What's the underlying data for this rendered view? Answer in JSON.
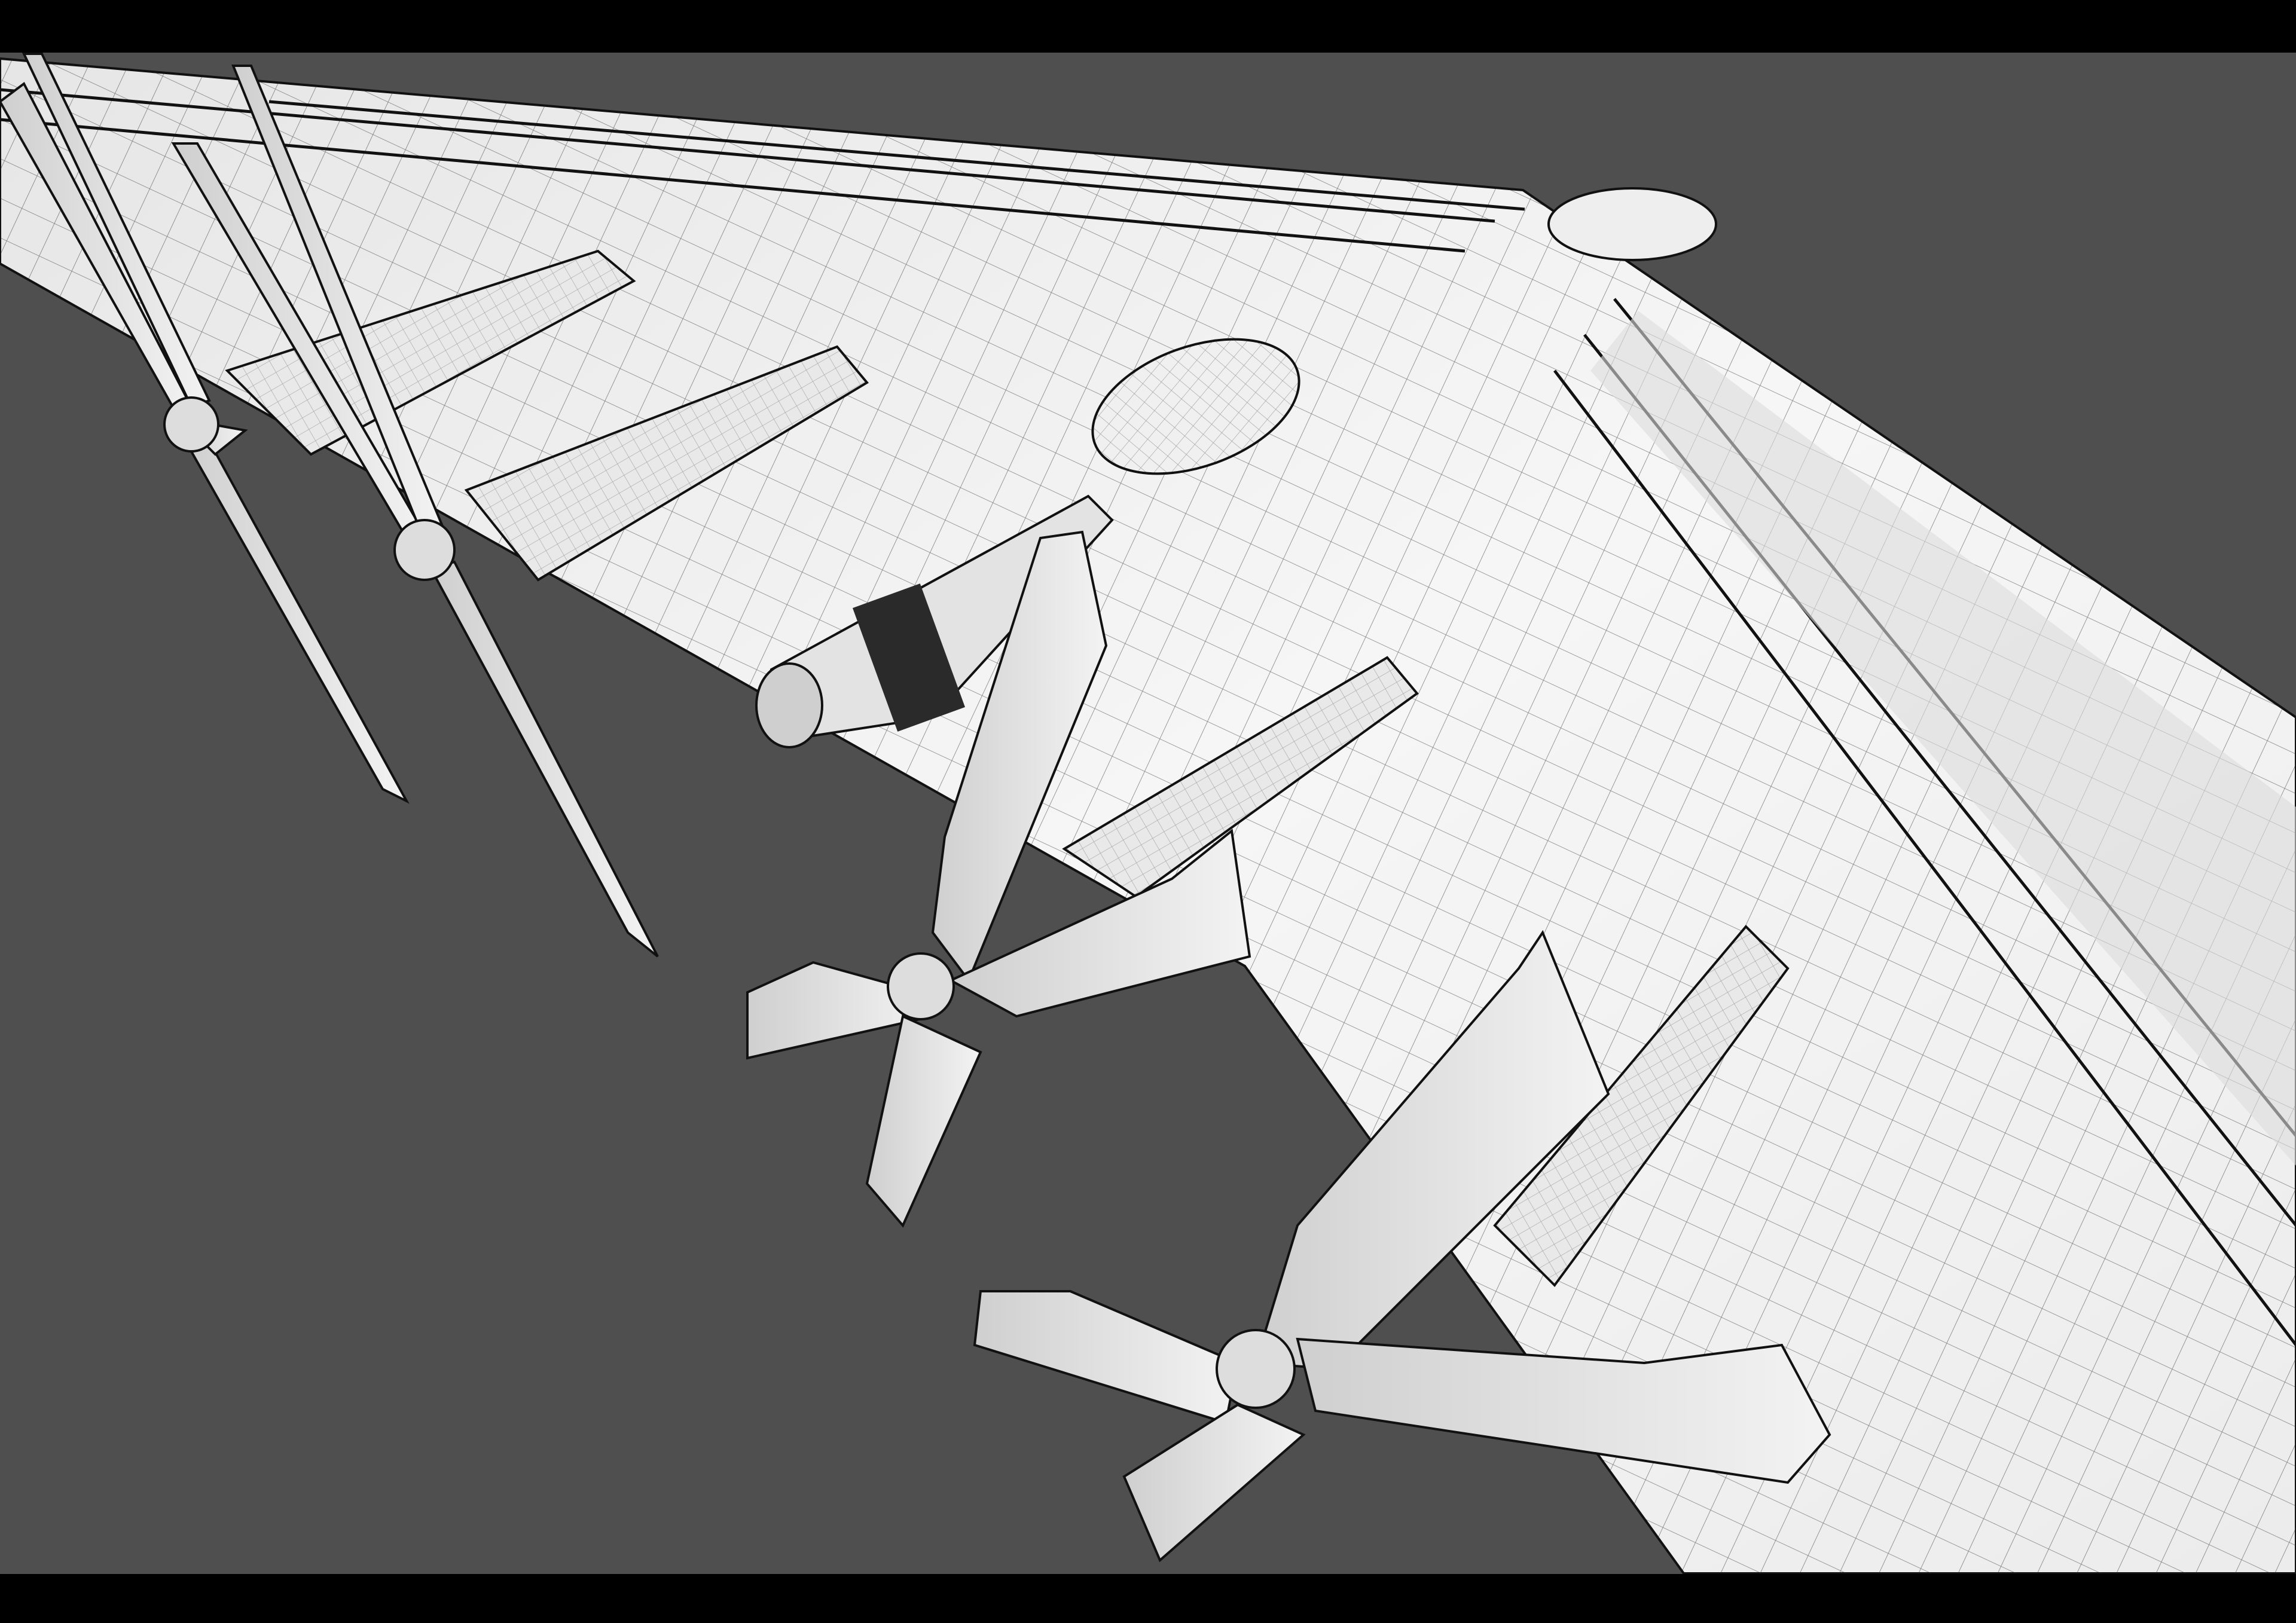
{
  "colors": {
    "letterbox": "#000000",
    "background": "#4f4f4f",
    "surface": "#f2f2f2",
    "surface_shade": "#d9d9d9",
    "wire": "#1a1a1a"
  }
}
